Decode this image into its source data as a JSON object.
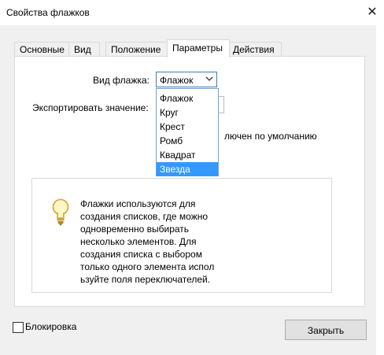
{
  "window": {
    "title": "Свойства флажков",
    "close_glyph": "✕"
  },
  "tabs": [
    {
      "label": "Основные"
    },
    {
      "label": "Вид"
    },
    {
      "label": "Положение"
    },
    {
      "label": "Параметры",
      "active": true
    },
    {
      "label": "Действия"
    }
  ],
  "options": {
    "style_label": "Вид флажка:",
    "style_value": "Флажок",
    "style_options": [
      "Флажок",
      "Круг",
      "Крест",
      "Ромб",
      "Квадрат",
      "Звезда"
    ],
    "highlighted_option": "Звезда",
    "export_label": "Экспортировать значение:",
    "default_checked_text": "лючен по умолчанию"
  },
  "tip": {
    "icon": "lightbulb-icon",
    "lines": [
      "Флажки используются для",
      "создания списков, где можно",
      "одновременно выбирать",
      "несколько элементов. Для",
      "создания списка с выбором",
      "только одного элемента испол",
      "ьзуйте поля переключателей."
    ]
  },
  "footer": {
    "lock_label": "Блокировка",
    "lock_checked": false,
    "close_label": "Закрыть"
  },
  "colors": {
    "accent": "#3399ff",
    "select_border": "#3c7fb1"
  }
}
